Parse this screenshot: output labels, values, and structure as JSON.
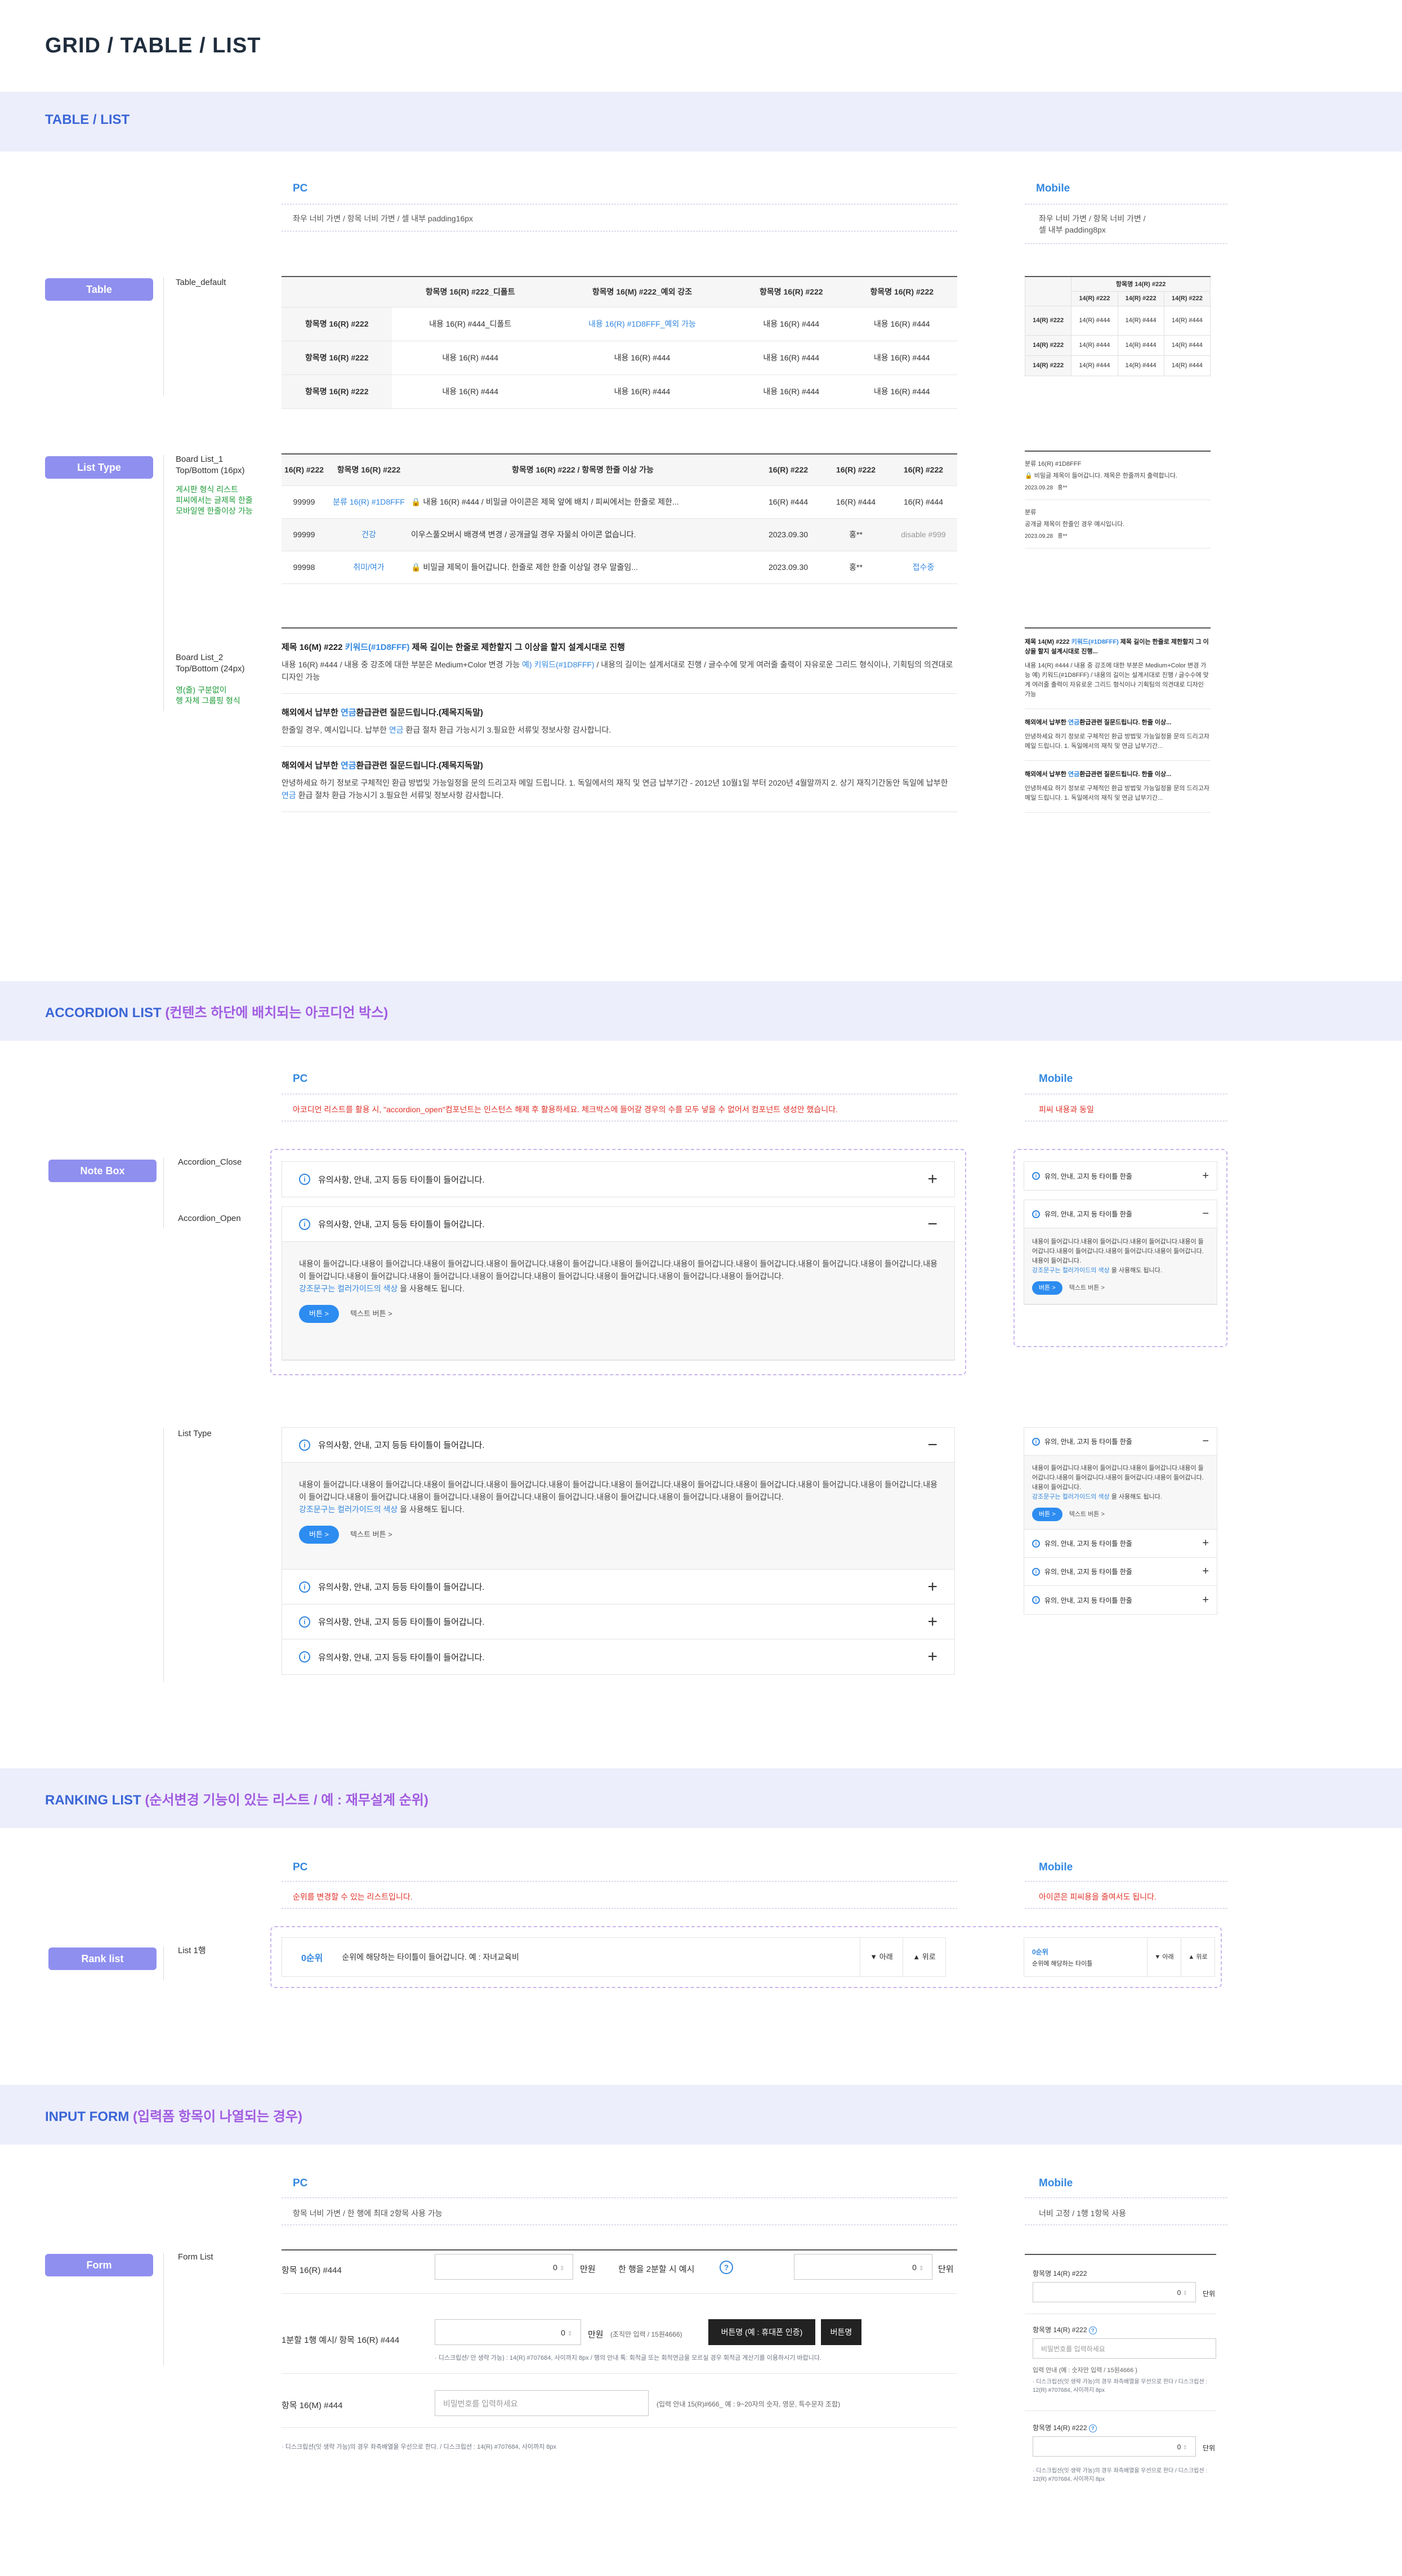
{
  "page_title": "GRID / TABLE / LIST",
  "sections": {
    "table_list": "TABLE / LIST",
    "accordion": {
      "main": "ACCORDION LIST",
      "sub": "(컨텐츠 하단에 배치되는 아코디언 박스)"
    },
    "ranking": {
      "main": "RANKING LIST",
      "sub": "(순서변경 기능이 있는 리스트 / 예 : 재무설계 순위)"
    },
    "input": {
      "main": "INPUT FORM",
      "sub": "(입력폼 항목이 나열되는 경우)"
    }
  },
  "cols": {
    "pc": "PC",
    "mobile": "Mobile"
  },
  "table_section": {
    "pc_desc": "좌우 너비 가변 / 항목 너비 가변 / 셀 내부 padding16px",
    "mobile_desc": "좌우 너비 가변 / 항목 너비 가변 /\n셀 내부 padding8px",
    "pill": "Table",
    "label": "Table_default",
    "headers": [
      "항목명 16(R) #222_디폴트",
      "항목명 16(M) #222_예외 강조",
      "항목명 16(R) #222",
      "항목명 16(R) #222"
    ],
    "rows": [
      [
        "항목명 16(R) #222",
        "내용 16(R) #444_디폴트",
        "내용 16(R) #1D8FFF_예외 가능",
        "내용 16(R) #444",
        "내용 16(R) #444"
      ],
      [
        "항목명 16(R) #222",
        "내용 16(R) #444",
        "내용 16(R) #444",
        "내용 16(R) #444",
        "내용 16(R) #444"
      ],
      [
        "항목명 16(R) #222",
        "내용 16(R) #444",
        "내용 16(R) #444",
        "내용 16(R) #444",
        "내용 16(R) #444"
      ]
    ],
    "m_header": "항목명 14(R) #222",
    "m_sub": [
      "14(R) #222",
      "14(R) #222",
      "14(R) #222"
    ],
    "m_rows": [
      [
        "14(R) #222",
        "14(R) #444",
        "14(R) #444",
        "14(R) #444"
      ],
      [
        "14(R) #222",
        "14(R) #444",
        "14(R) #444",
        "14(R) #444"
      ],
      [
        "14(R) #222",
        "14(R) #444",
        "14(R) #444",
        "14(R) #444"
      ]
    ]
  },
  "list_section": {
    "pill": "List Type",
    "b1_label": "Board List_1\nTop/Bottom (16px)",
    "b1_note": "게시판 형식 리스트\n피씨에서는 글제목 한줄\n모바일엔 한줄이상 가능",
    "b2_label": "Board List_2\nTop/Bottom (24px)",
    "b2_note": "영(줄) 구분없이\n행 자체 그룹핑 형식",
    "b1_headers": [
      "16(R) #222",
      "항목명 16(R) #222",
      "항목명 16(R) #222 / 항목명 한줄 이상 가능",
      "16(R) #222",
      "16(R) #222",
      "16(R) #222"
    ],
    "b1_rows": [
      [
        "99999",
        "분류 16(R) #1D8FFF",
        "내용 16(R) #444 / 비밀글 아이콘은 제목 앞에 배치 / 피씨에서는 한줄로 제한...",
        "16(R) #444",
        "16(R) #444",
        "16(R) #444"
      ],
      [
        "99999",
        "건강",
        "이우스풀오버시 배경색 변경 / 공개글일 경우 자물쇠 아이콘 없습니다.",
        "2023.09.30",
        "홍**",
        "disable #999"
      ],
      [
        "99998",
        "취미/여가",
        "비밀글 제목이 들어갑니다. 한줄로 제한 한줄 이상일 경우 말줄임...",
        "2023.09.30",
        "홍**",
        "접수중"
      ]
    ],
    "m_b1": [
      {
        "cat": "분류 16(R) #1D8FFF",
        "title": "비밀글 제목이 들어갑니다. 제목은 한줄까지 출력합니다.",
        "date": "2023.09.28",
        "name": "홍**"
      },
      {
        "cat": "분류",
        "title": "공개글 제목이 한줄인 경우 예시입니다.",
        "date": "2023.09.28",
        "name": "홍**"
      }
    ],
    "b2": [
      {
        "title_a": "제목 16(M) #222 ",
        "title_hl": "키워드(#1D8FFF)",
        "title_b": " 제목 길이는 한줄로 제한할지 그 이상을 할지 설계시대로 진행",
        "body_a": "내용 16(R) #444 / 내용 중 강조에 대한 부분은 Medium+Color 변경 가능 ",
        "body_hl": "예) 키워드(#1D8FFF)",
        "body_b": " / 내용의 길이는 설계서대로 진행 / 글수수에 맞게 여러줄 출력이 자유로운 그리드 형식이나, 기획팀의 의견대로 디자인 가능"
      },
      {
        "title_a": "해외에서 납부한 ",
        "title_hl": "연금",
        "title_b": "환급관련 질문드립니다.(제목지독말)",
        "body_a": "한줄일 경우, 예시입니다. 납부한 ",
        "body_hl": "연금",
        "body_b": " 환급 절차 환급 가능시기 3.필요한 서류및 정보사항 감사합니다."
      },
      {
        "title_a": "해외에서 납부한 ",
        "title_hl": "연금",
        "title_b": "환급관련 질문드립니다.(제목지독말)",
        "body_a": "안녕하세요 하기 정보로 구체적인 환급 방법및 가능일정을 문의 드리고자 메일 드립니다. 1. 독일에서의 재직 및 연금 납부기간 - 2012년 10월1일 부터 2020년 4월말까지 2. 상기 재직기간동안 독일에 납부한 ",
        "body_hl": "연금",
        "body_b": " 환급 절차 환급 가능시기 3.필요한 서류및 정보사항 감사합니다."
      }
    ],
    "m_b2": [
      {
        "title_a": "제목 14(M) #222 ",
        "title_hl": "키워드(#1D8FFF)",
        "title_b": " 제목 길이는 한줄로 제한할지 그 이상을 할지 설계시대로 진행...",
        "body": "내용 14(R) #444 / 내용 중 강조에 대한 부분은 Medium+Color 변경 가능 예) 키워드(#1D8FFF) / 내용의 길이는 설계서대로 진행 / 글수수에 맞게 여러줄 출력이 자유로운 그리드 형식이나 기획팀의 의견대로 디자인 가능"
      },
      {
        "title_a": "해외에서 납부한 ",
        "title_hl": "연금",
        "title_b": "환급관련 질문드립니다. 한줄 이상...",
        "body": "안녕하세요 하기 정보로 구체적인 환급 방법및 가능일정을 문의 드리고자 메일 드립니다. 1. 독일에서의 재직 및 연금 납부기간..."
      },
      {
        "title_a": "해외에서 납부한 ",
        "title_hl": "연금",
        "title_b": "환급관련 질문드립니다. 한줄 이상...",
        "body": "안녕하세요 하기 정보로 구체적인 환급 방법및 가능일정을 문의 드리고자 메일 드립니다. 1. 독일에서의 재직 및 연금 납부기간..."
      }
    ]
  },
  "accordion_section": {
    "pc_note": "아코디언 리스트를 활용 시, \"accordion_open\"컴포넌트는 인스턴스 해제 후 활용하세요. 체크박스에 들어갈 경우의 수를 모두 넣을 수 없어서 컴포넌트 생성안 했습니다.",
    "m_note": "피씨 내용과 동일",
    "pill1": "Note Box",
    "lbl_close": "Accordion_Close",
    "lbl_open": "Accordion_Open",
    "pill2_label": "List Type",
    "title": "유의사항, 안내, 고지 등등 타이틀이 들어갑니다.",
    "m_title": "유의, 안내, 고지 등 타이틀 한줄",
    "body": "내용이 들어갑니다.내용이 들어갑니다.내용이 들어갑니다.내용이 들어갑니다.내용이 들어갑니다.내용이 들어갑니다.내용이 들어갑니다.내용이 들어갑니다.내용이 들어갑니다.내용이 들어갑니다.내용이 들어갑니다.내용이 들어갑니다.내용이 들어갑니다.내용이 들어갑니다.내용이 들어갑니다.내용이 들어갑니다.내용이 들어갑니다.내용이 들어갑니다.",
    "link_a": "강조문구는 컬러가이드의 색상",
    "link_b": " 을 사용해도 됩니다.",
    "m_body": "내용이 들어갑니다.내용이 들어갑니다.내용이 들어갑니다.내용이 들어갑니다.내용이 들어갑니다.내용이 들어갑니다.내용이 들어갑니다.내용이 들어갑니다.",
    "btn": "버튼 >",
    "txtbtn": "텍스트 버튼 >"
  },
  "ranking_section": {
    "pc_note": "순위를 변경할 수 있는 리스트입니다.",
    "m_note": "아이콘은 피씨용을 줄여서도 됩니다.",
    "pill": "Rank list",
    "label": "List 1행",
    "rank": "0순위",
    "text": "순위에 해당하는 타이틀이 들어갑니다. 예 : 자녀교육비",
    "down": "▼ 아래",
    "up": "▲ 위로",
    "m_rank": "0순위",
    "m_text": "순위에 해당하는 타이틀",
    "m_down": "▼ 아래",
    "m_up": "▲ 위로"
  },
  "input_section": {
    "pc_desc": "항목 너비 가변 / 한 행에 최대 2항목 사용 가능",
    "m_desc": "너비 고정 / 1행 1항목 사용",
    "pill": "Form",
    "label": "Form List",
    "row1_label": "항목 16(R) #444",
    "row1_value": "0",
    "row1_unit": "만원",
    "row1b_label": "한 행을 2분할 시 예시",
    "row1b_value": "0",
    "row1b_unit": "단위",
    "row2_label": "1분할 1행 예시/ 항목 16(R) #444",
    "row2_value": "0",
    "row2_unit": "만원",
    "row2_hint": "(조직만 입력 / 15원4666)",
    "row2_btn1": "버튼명 (예 : 휴대폰 인증)",
    "row2_btn2": "버튼명",
    "row2_desc": "디스크립션/ 안 생략 가능) : 14(R) #707684, 사이까지 8px / 행의 안내 톡: 회적글 또는 회적연금을 모르실 경우 회적금 계산기를 이용하시기 바랍니다.",
    "row3_label": "항목 16(M) #444",
    "row3_placeholder": "비밀번호를 입력하세요",
    "row3_hint": "(입력 안내 15(R)#666_ 예 : 9~20자의 숫자, 영문, 특수문자 조합)",
    "footnote": "디스크립션(잇 생략 가능)의 경우 좌측배열을 우선으로 한다. / 디스크립션 : 14(R) #707684, 사이까지 8px",
    "m_fields": [
      {
        "label": "항목명 14(R) #222",
        "value": "0",
        "unit": "단위"
      },
      {
        "label": "항목명 14(R) #222",
        "placeholder": "비밀번호를 입력하세요",
        "hint": "입력 안내 (예 : 숫자만 입력 / 15원4666 )",
        "desc": "디스크립션(잇 생략 가능)의 경우 좌측배열을 우선으로 한다 / 디스크립션 : 12(R) #707684, 사이까지 8px"
      },
      {
        "label": "항목명 14(R) #222",
        "value": "0",
        "unit": "단위",
        "desc": "디스크립션(잇 생략 가능)의 경우 좌측배열을 우선으로 한다 / 디스크립션 : 12(R) #707684, 사이까지 8px"
      }
    ]
  }
}
